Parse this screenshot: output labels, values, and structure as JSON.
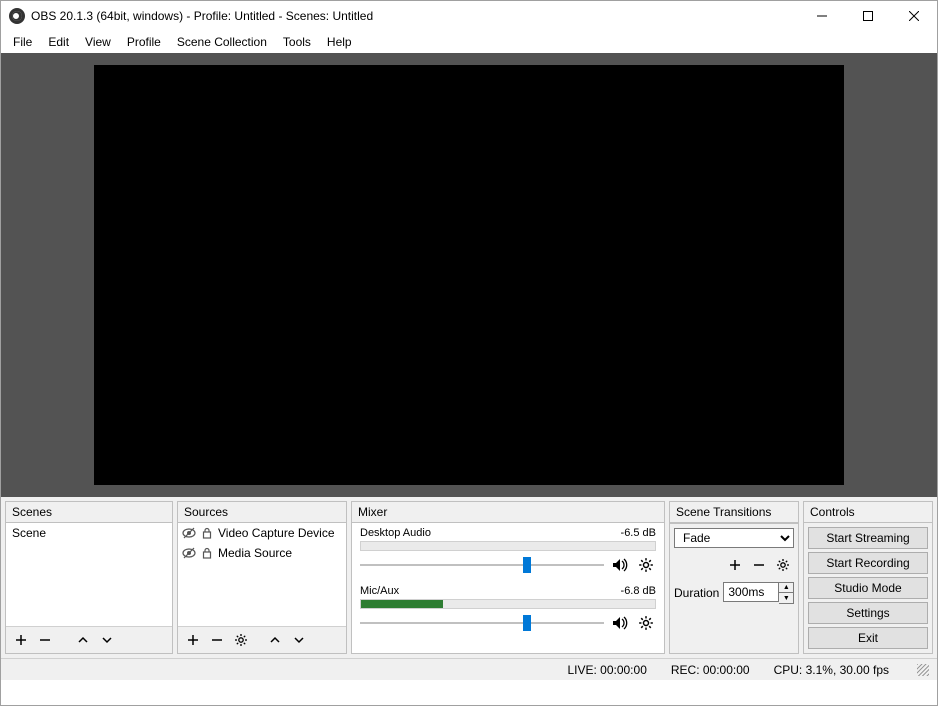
{
  "titlebar": {
    "title": "OBS 20.1.3 (64bit, windows) - Profile: Untitled - Scenes: Untitled"
  },
  "menu": {
    "file": "File",
    "edit": "Edit",
    "view": "View",
    "profile": "Profile",
    "scene_collection": "Scene Collection",
    "tools": "Tools",
    "help": "Help"
  },
  "panels": {
    "scenes_title": "Scenes",
    "sources_title": "Sources",
    "mixer_title": "Mixer",
    "transitions_title": "Scene Transitions",
    "controls_title": "Controls"
  },
  "scenes": {
    "items": [
      {
        "name": "Scene"
      }
    ]
  },
  "sources": {
    "items": [
      {
        "name": "Video Capture Device"
      },
      {
        "name": "Media Source"
      }
    ]
  },
  "mixer": {
    "channels": [
      {
        "name": "Desktop Audio",
        "db": "-6.5 dB",
        "slider_pct": 67,
        "meter_pct": 0,
        "meter_color": "#4caf50"
      },
      {
        "name": "Mic/Aux",
        "db": "-6.8 dB",
        "slider_pct": 67,
        "meter_pct": 28,
        "meter_color": "#2e7d32"
      }
    ]
  },
  "transitions": {
    "selected": "Fade",
    "duration_label": "Duration",
    "duration_value": "300ms"
  },
  "controls": {
    "start_streaming": "Start Streaming",
    "start_recording": "Start Recording",
    "studio_mode": "Studio Mode",
    "settings": "Settings",
    "exit": "Exit"
  },
  "statusbar": {
    "live": "LIVE: 00:00:00",
    "rec": "REC: 00:00:00",
    "cpu": "CPU: 3.1%, 30.00 fps"
  }
}
